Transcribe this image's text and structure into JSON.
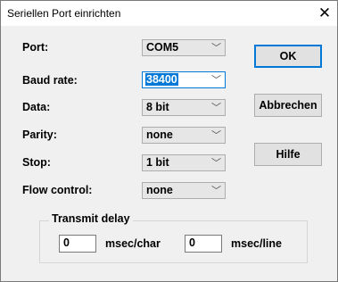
{
  "window": {
    "title": "Seriellen Port einrichten",
    "close_glyph": "✕"
  },
  "fields": {
    "port": {
      "label": "Port:",
      "value": "COM5"
    },
    "baud": {
      "label": "Baud rate:",
      "value": "38400"
    },
    "data": {
      "label": "Data:",
      "value": "8 bit"
    },
    "parity": {
      "label": "Parity:",
      "value": "none"
    },
    "stop": {
      "label": "Stop:",
      "value": "1 bit"
    },
    "flow": {
      "label": "Flow control:",
      "value": "none"
    }
  },
  "buttons": {
    "ok": "OK",
    "cancel": "Abbrechen",
    "help": "Hilfe"
  },
  "transmit_delay": {
    "title": "Transmit delay",
    "char_value": "0",
    "char_unit": "msec/char",
    "line_value": "0",
    "line_unit": "msec/line"
  },
  "icons": {
    "dropdown": "chevron-down-icon",
    "close": "close-icon"
  },
  "colors": {
    "accent": "#0078d7",
    "dialog_bg": "#f0f0f0",
    "titlebar_bg": "#ffffff"
  }
}
